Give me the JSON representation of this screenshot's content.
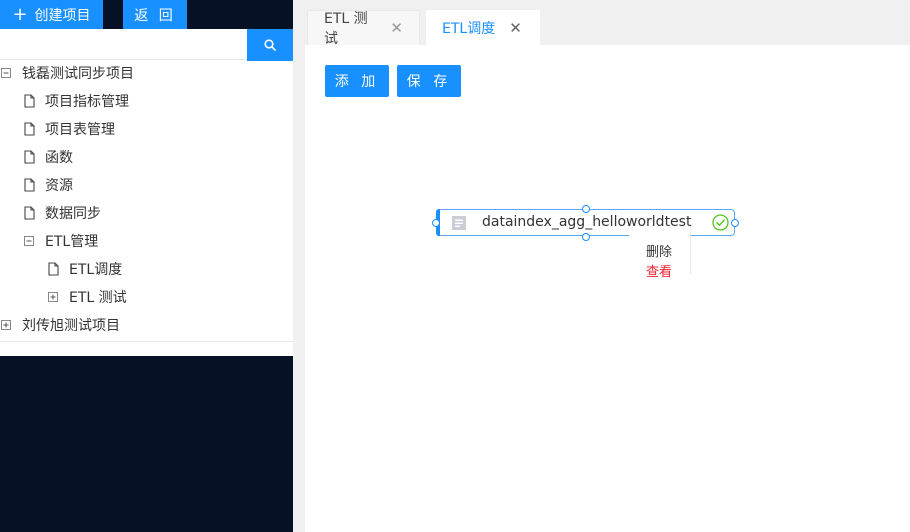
{
  "sidebar": {
    "create_label": "创建项目",
    "back_label": "返 回",
    "search": {
      "value": "",
      "placeholder": ""
    },
    "tree": [
      {
        "label": "钱磊测试同步项目",
        "type": "minus"
      },
      {
        "label": "项目指标管理",
        "type": "file"
      },
      {
        "label": "项目表管理",
        "type": "file"
      },
      {
        "label": "函数",
        "type": "file"
      },
      {
        "label": "资源",
        "type": "file"
      },
      {
        "label": "数据同步",
        "type": "file"
      },
      {
        "label": "ETL管理",
        "type": "minus"
      },
      {
        "label": "ETL调度",
        "type": "file"
      },
      {
        "label": "ETL 测试",
        "type": "plus"
      },
      {
        "label": "刘传旭测试项目",
        "type": "plus"
      }
    ]
  },
  "tabs": [
    {
      "label": "ETL 测试",
      "close": "✕",
      "active": false
    },
    {
      "label": "ETL调度",
      "close": "✕",
      "active": true
    }
  ],
  "toolbar": {
    "add_label": "添 加",
    "save_label": "保 存"
  },
  "canvas": {
    "node": {
      "label": "dataindex_agg_helloworldtest",
      "status": "success"
    },
    "context_menu": {
      "delete_label": "删除",
      "view_label": "查看"
    }
  },
  "colors": {
    "primary": "#1890ff",
    "sidebar_bg": "#061126",
    "danger": "#f5222d",
    "success": "#52c41a"
  }
}
